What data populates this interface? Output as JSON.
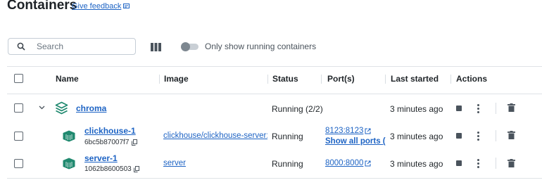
{
  "header": {
    "title": "Containers",
    "feedback": "Give feedback"
  },
  "toolbar": {
    "search_placeholder": "Search",
    "toggle_label": "Only show running containers",
    "toggle_on": false
  },
  "table": {
    "columns": [
      "Name",
      "Image",
      "Status",
      "Port(s)",
      "Last started",
      "Actions"
    ],
    "group": {
      "name": "chroma",
      "status": "Running (2/2)",
      "last_started": "3 minutes ago"
    },
    "rows": [
      {
        "name": "clickhouse-1",
        "id": "6bc5b87007f7",
        "image": "clickhouse/clickhouse-server:",
        "status": "Running",
        "port": "8123:8123",
        "port_extra": "Show all ports (2",
        "last_started": "3 minutes ago"
      },
      {
        "name": "server-1",
        "id": "1062b8600503",
        "image": "server",
        "status": "Running",
        "port": "8000:8000",
        "last_started": "3 minutes ago"
      }
    ]
  },
  "colors": {
    "accent": "#1d63c4",
    "icon_teal": "#20896f"
  },
  "icons": [
    "search-icon",
    "columns-icon",
    "external-link-icon",
    "copy-icon",
    "stack-icon",
    "container-icon",
    "stop-icon",
    "more-vertical-icon",
    "trash-icon",
    "chevron-down-icon"
  ]
}
